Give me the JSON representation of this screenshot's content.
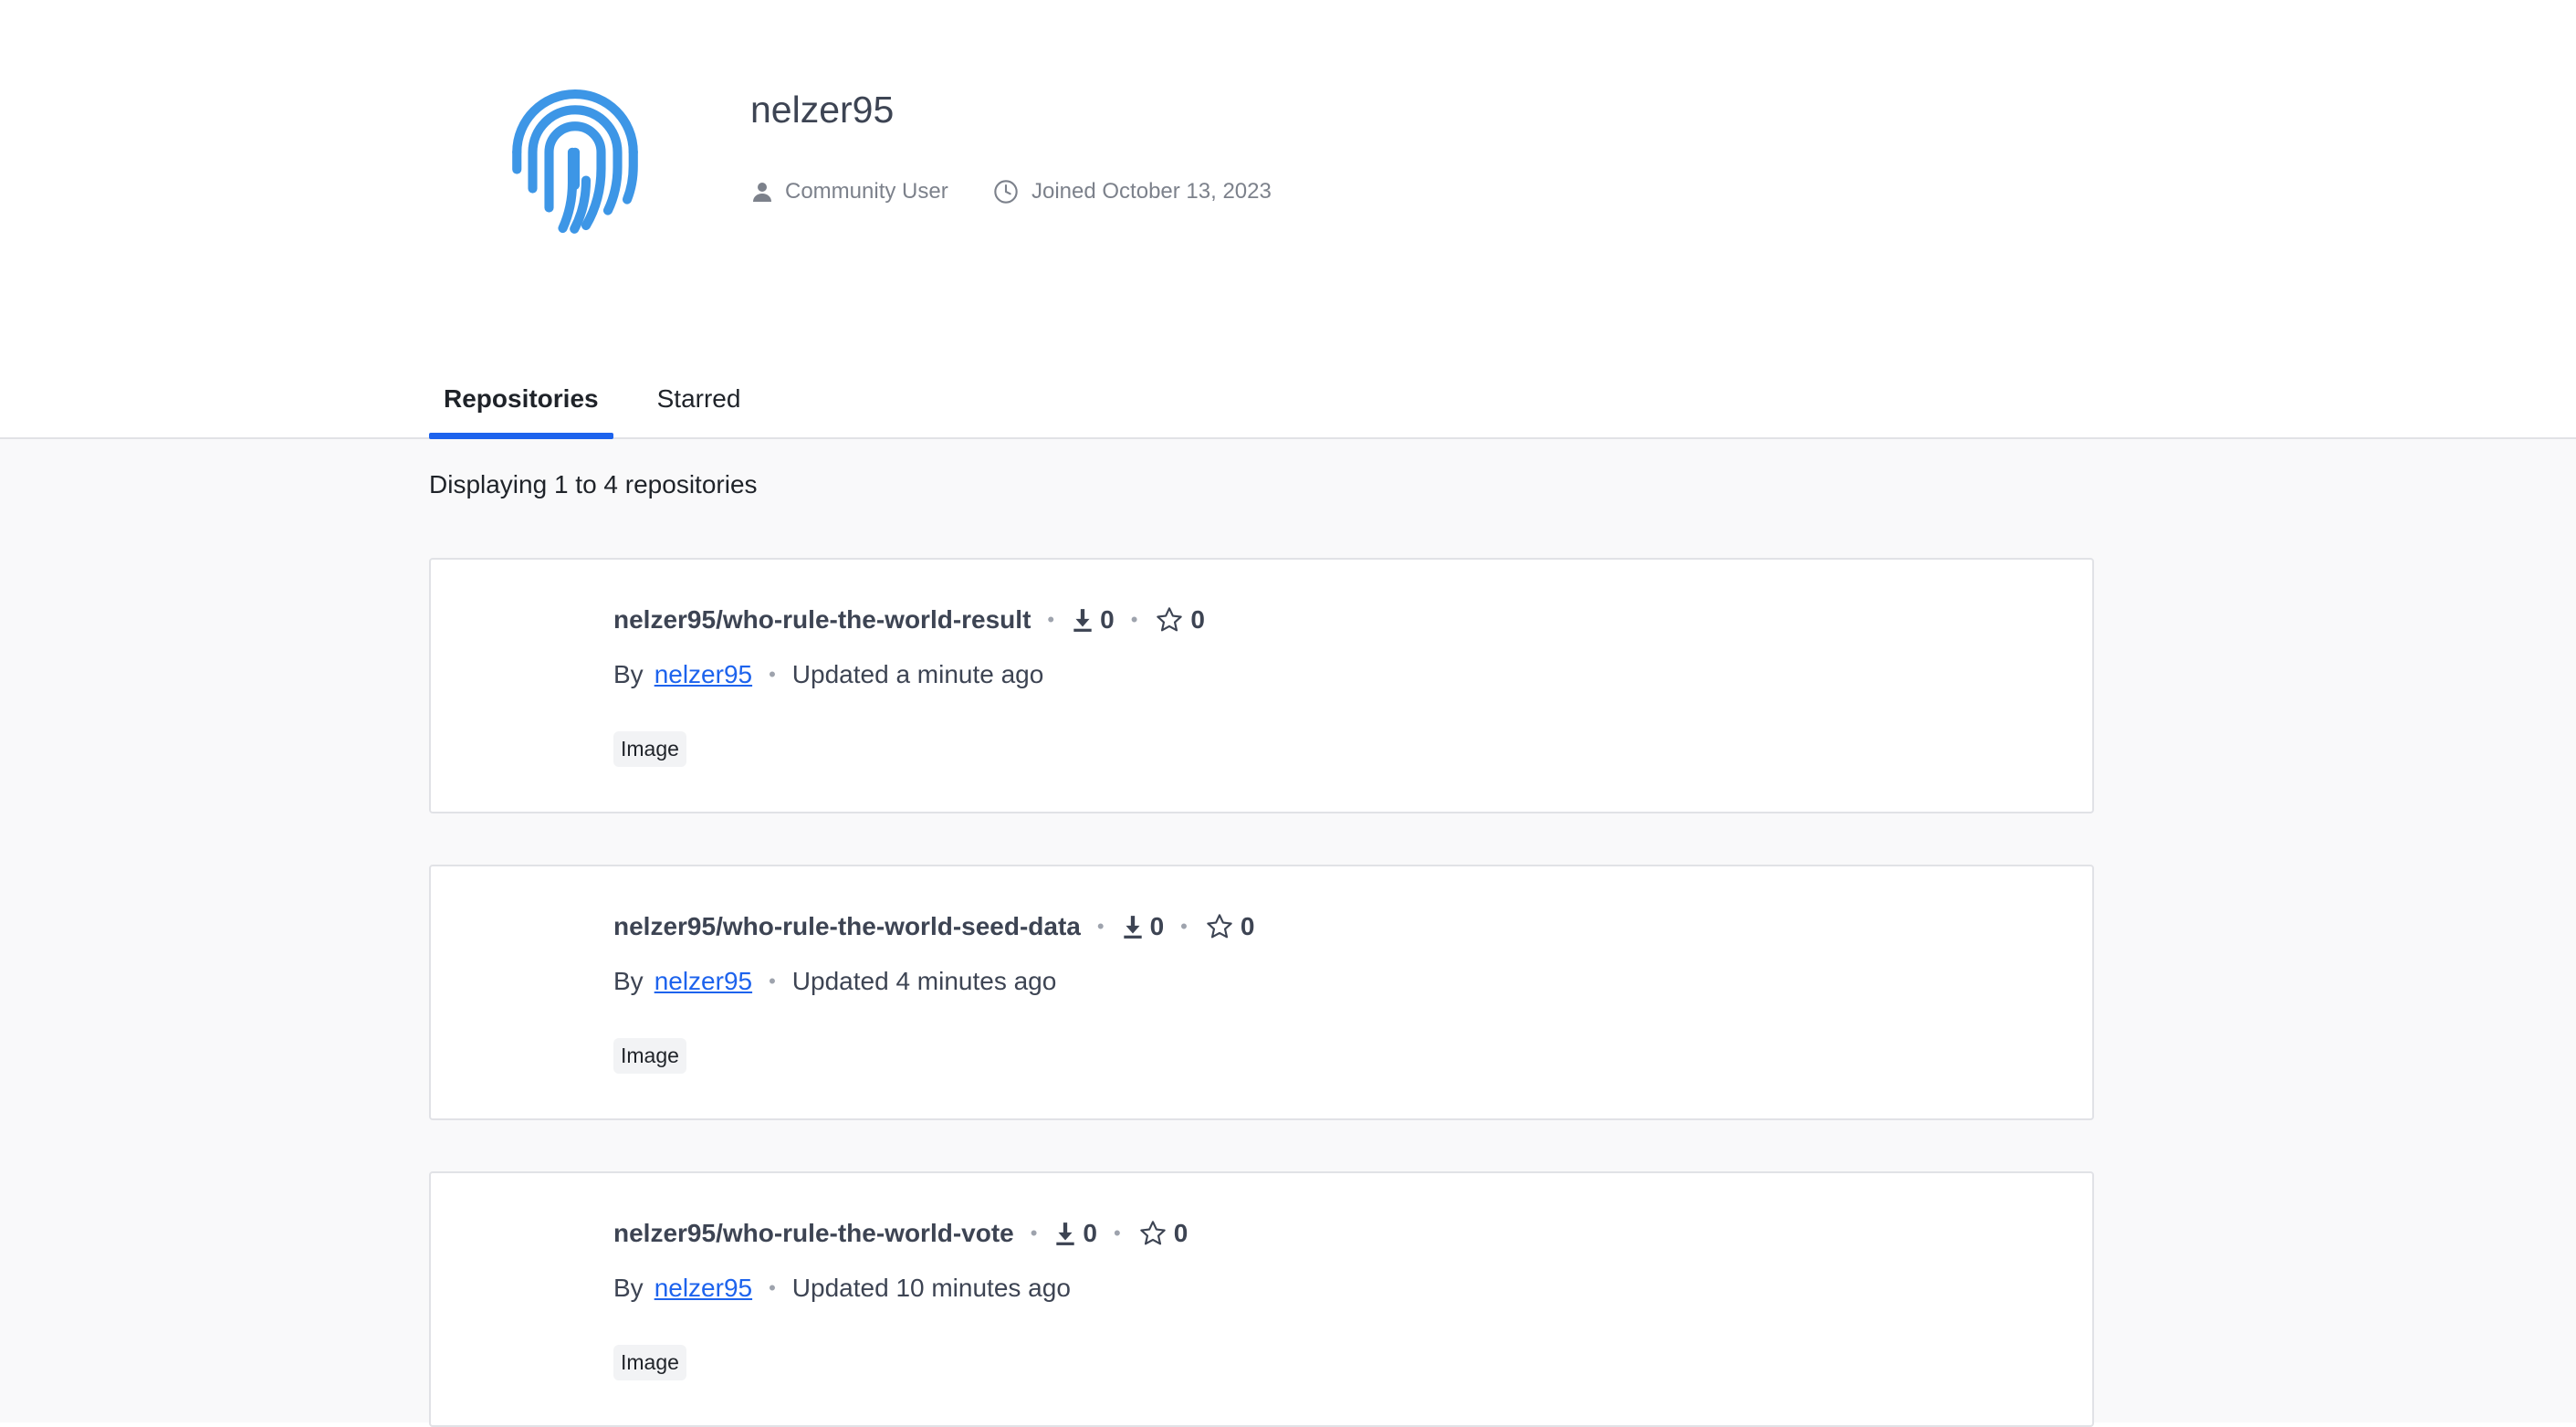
{
  "profile": {
    "username": "nelzer95",
    "role": "Community User",
    "joined": "Joined October 13, 2023",
    "avatar_icon": "fingerprint-icon",
    "avatar_color": "#3d96e6"
  },
  "tabs": [
    {
      "label": "Repositories",
      "active": true
    },
    {
      "label": "Starred",
      "active": false
    }
  ],
  "listing": {
    "summary": "Displaying 1 to 4 repositories"
  },
  "repositories": [
    {
      "name": "nelzer95/who-rule-the-world-result",
      "downloads": "0",
      "stars": "0",
      "by_label": "By",
      "owner": "nelzer95",
      "updated": "Updated a minute ago",
      "badge": "Image"
    },
    {
      "name": "nelzer95/who-rule-the-world-seed-data",
      "downloads": "0",
      "stars": "0",
      "by_label": "By",
      "owner": "nelzer95",
      "updated": "Updated 4 minutes ago",
      "badge": "Image"
    },
    {
      "name": "nelzer95/who-rule-the-world-vote",
      "downloads": "0",
      "stars": "0",
      "by_label": "By",
      "owner": "nelzer95",
      "updated": "Updated 10 minutes ago",
      "badge": "Image"
    }
  ],
  "colors": {
    "accent": "#1d63ed",
    "link": "#1d63ed"
  }
}
